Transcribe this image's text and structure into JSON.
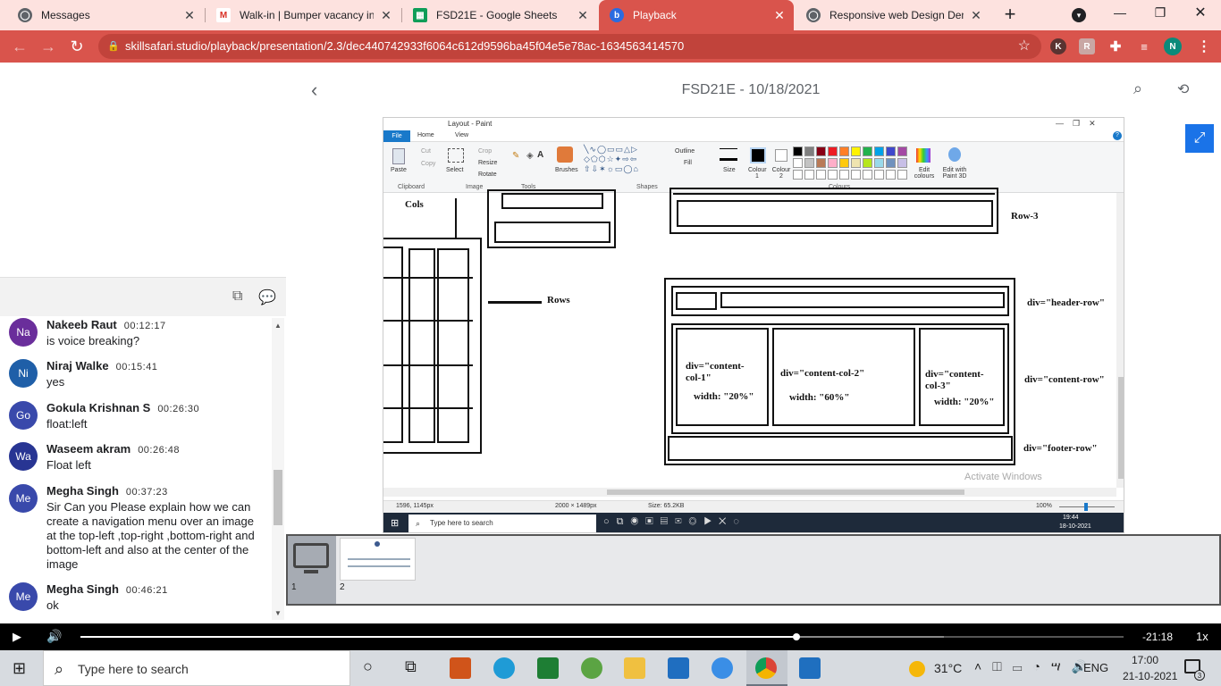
{
  "browser": {
    "tabs": [
      {
        "label": "Messages",
        "icon": "globe-icon"
      },
      {
        "label": "Walk-in | Bumper vacancy in",
        "icon": "gmail-icon"
      },
      {
        "label": "FSD21E - Google Sheets",
        "icon": "sheets-icon"
      },
      {
        "label": "Playback",
        "icon": "b-logo-icon"
      },
      {
        "label": "Responsive web Design Dem",
        "icon": "globe-icon"
      }
    ],
    "url": "skillsafari.studio/playback/presentation/2.3/dec440742933f6064c612d9596ba45f04e5e78ac-1634563414570",
    "profile_initial": "N",
    "ext_initial": "K",
    "accent_color": "#d9544c"
  },
  "presentation": {
    "title": "FSD21E - 10/18/2021",
    "slides": [
      "1",
      "2"
    ]
  },
  "chat": {
    "messages": [
      {
        "initials": "Na",
        "name": "Nakeeb Raut",
        "time": "00:12:17",
        "text": "is voice breaking?",
        "color": "#6a2e9b"
      },
      {
        "initials": "Ni",
        "name": "Niraj Walke",
        "time": "00:15:41",
        "text": "yes",
        "color": "#1f5fa8"
      },
      {
        "initials": "Go",
        "name": "Gokula Krishnan S",
        "time": "00:26:30",
        "text": "float:left",
        "color": "#3949ab"
      },
      {
        "initials": "Wa",
        "name": "Waseem akram",
        "time": "00:26:48",
        "text": "Float left",
        "color": "#283593"
      },
      {
        "initials": "Me",
        "name": "Megha Singh",
        "time": "00:37:23",
        "text": "Sir Can you Please explain how we can create a navigation menu over an image at the top-left ,top-right ,bottom-right and bottom-left and also at the center of the image",
        "color": "#3949ab"
      },
      {
        "initials": "Me",
        "name": "Megha Singh",
        "time": "00:46:21",
        "text": "ok",
        "color": "#3949ab"
      }
    ]
  },
  "paint": {
    "title": "Layout - Paint",
    "menu": [
      "File",
      "Home",
      "View"
    ],
    "groups": [
      "Clipboard",
      "Image",
      "Tools",
      "Shapes",
      "Colours"
    ],
    "tools": {
      "paste": "Paste",
      "cut": "Cut",
      "copy": "Copy",
      "select": "Select",
      "crop": "Crop",
      "resize": "Resize",
      "rotate": "Rotate",
      "brushes": "Brushes",
      "outline": "Outline",
      "fill": "Fill",
      "size": "Size",
      "colour1": "Colour 1",
      "colour2": "Colour 2",
      "edit_colours": "Edit colours",
      "paint3d": "Edit with Paint 3D"
    },
    "canvas": {
      "cols": "Cols",
      "rows": "Rows",
      "row3": "Row-3",
      "header_row": "div=\"header-row\"",
      "content_row": "div=\"content-row\"",
      "footer_row": "div=\"footer-row\"",
      "col1": "div=\"content-col-1\"",
      "col1_width": "width: \"20%\"",
      "col2": "div=\"content-col-2\"",
      "col2_width": "width: \"60%\"",
      "col3": "div=\"content-col-3\"",
      "col3_width": "width: \"20%\""
    },
    "watermark": "Activate Windows",
    "status": {
      "cursor": "1596, 1145px",
      "dims": "2000 × 1489px",
      "size": "Size: 65.2KB",
      "zoom": "100%"
    },
    "inner_taskbar": {
      "search": "Type here to search",
      "time": "19:44",
      "date": "18-10-2021"
    }
  },
  "player": {
    "remaining": "-21:18",
    "speed": "1x",
    "progress": 0.686
  },
  "taskbar": {
    "search_placeholder": "Type here to search",
    "temperature": "31°C",
    "language": "ENG",
    "time": "17:00",
    "date": "21-10-2021",
    "notifications": "3"
  }
}
